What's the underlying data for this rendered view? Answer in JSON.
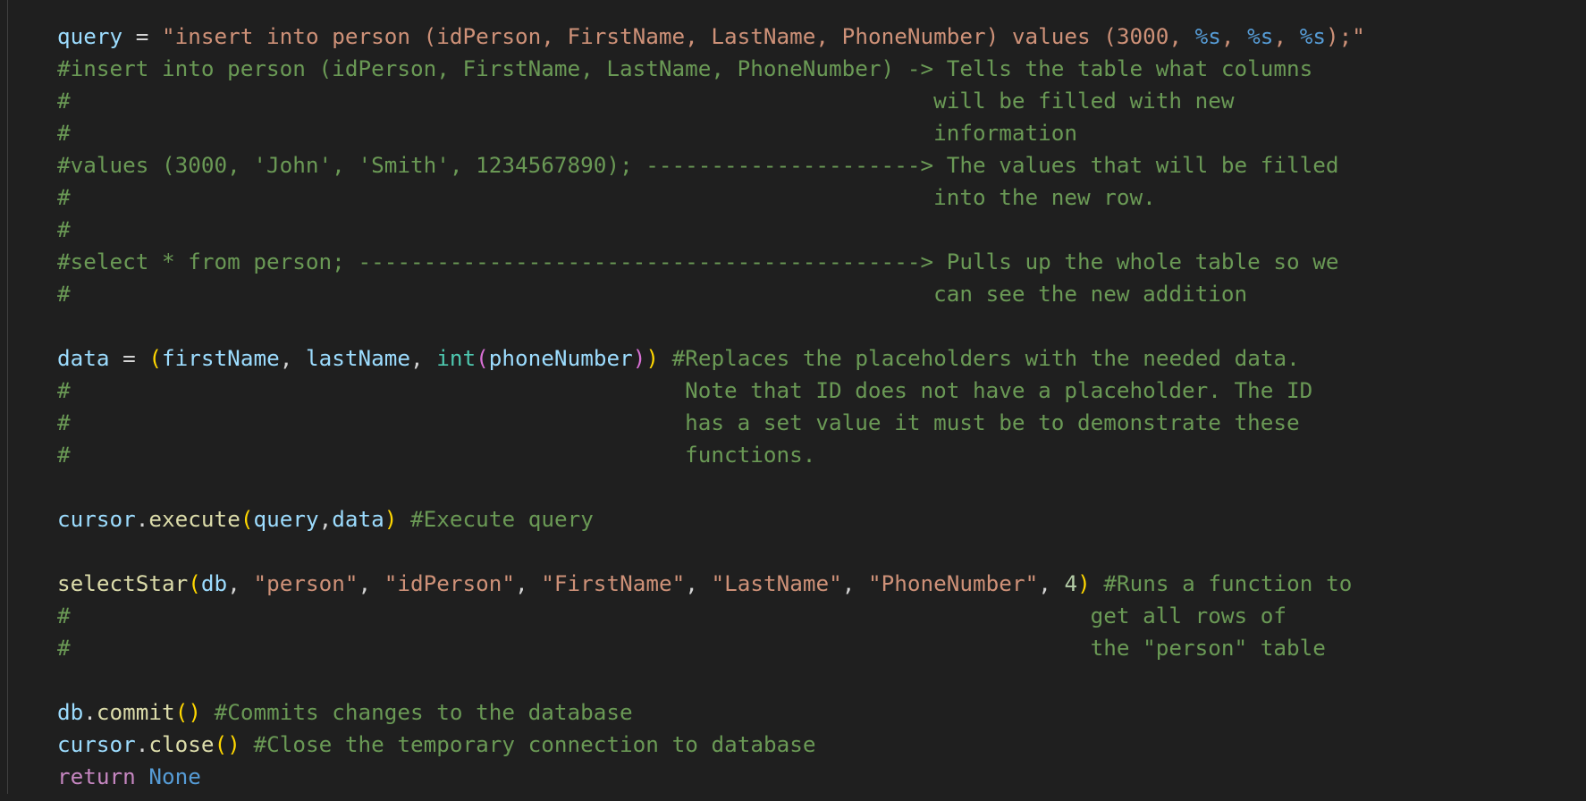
{
  "lines": [
    {
      "segs": [
        {
          "t": "query",
          "c": "v"
        },
        {
          "t": " = ",
          "c": "op"
        },
        {
          "t": "\"insert into person (idPerson, FirstName, LastName, PhoneNumber) values (3000, ",
          "c": "s"
        },
        {
          "t": "%s",
          "c": "e"
        },
        {
          "t": ", ",
          "c": "s"
        },
        {
          "t": "%s",
          "c": "e"
        },
        {
          "t": ", ",
          "c": "s"
        },
        {
          "t": "%s",
          "c": "e"
        },
        {
          "t": ");\"",
          "c": "s"
        }
      ]
    },
    {
      "segs": [
        {
          "t": "#insert into person (idPerson, FirstName, LastName, PhoneNumber) -> Tells the table what columns",
          "c": "c"
        }
      ]
    },
    {
      "segs": [
        {
          "t": "#                                                                  will be filled with new",
          "c": "c"
        }
      ]
    },
    {
      "segs": [
        {
          "t": "#                                                                  information",
          "c": "c"
        }
      ]
    },
    {
      "segs": [
        {
          "t": "#values (3000, 'John', 'Smith', 1234567890); ---------------------> The values that will be filled",
          "c": "c"
        }
      ]
    },
    {
      "segs": [
        {
          "t": "#                                                                  into the new row.",
          "c": "c"
        }
      ]
    },
    {
      "segs": [
        {
          "t": "#",
          "c": "c"
        }
      ]
    },
    {
      "segs": [
        {
          "t": "#select * from person; -------------------------------------------> Pulls up the whole table so we",
          "c": "c"
        }
      ]
    },
    {
      "segs": [
        {
          "t": "#                                                                  can see the new addition",
          "c": "c"
        }
      ]
    },
    {
      "segs": []
    },
    {
      "segs": [
        {
          "t": "data",
          "c": "v"
        },
        {
          "t": " = ",
          "c": "op"
        },
        {
          "t": "(",
          "c": "p1"
        },
        {
          "t": "firstName",
          "c": "v"
        },
        {
          "t": ", ",
          "c": "op"
        },
        {
          "t": "lastName",
          "c": "v"
        },
        {
          "t": ", ",
          "c": "op"
        },
        {
          "t": "int",
          "c": "b"
        },
        {
          "t": "(",
          "c": "p2"
        },
        {
          "t": "phoneNumber",
          "c": "v"
        },
        {
          "t": ")",
          "c": "p2"
        },
        {
          "t": ")",
          "c": "p1"
        },
        {
          "t": " ",
          "c": "op"
        },
        {
          "t": "#Replaces the placeholders with the needed data.",
          "c": "c"
        }
      ]
    },
    {
      "segs": [
        {
          "t": "#                                               Note that ID does not have a placeholder. The ID",
          "c": "c"
        }
      ]
    },
    {
      "segs": [
        {
          "t": "#                                               has a set value it must be to demonstrate these",
          "c": "c"
        }
      ]
    },
    {
      "segs": [
        {
          "t": "#                                               functions.",
          "c": "c"
        }
      ]
    },
    {
      "segs": []
    },
    {
      "segs": [
        {
          "t": "cursor",
          "c": "v"
        },
        {
          "t": ".",
          "c": "op"
        },
        {
          "t": "execute",
          "c": "f"
        },
        {
          "t": "(",
          "c": "p1"
        },
        {
          "t": "query",
          "c": "v"
        },
        {
          "t": ",",
          "c": "op"
        },
        {
          "t": "data",
          "c": "v"
        },
        {
          "t": ")",
          "c": "p1"
        },
        {
          "t": " ",
          "c": "op"
        },
        {
          "t": "#Execute query",
          "c": "c"
        }
      ]
    },
    {
      "segs": []
    },
    {
      "segs": [
        {
          "t": "selectStar",
          "c": "f"
        },
        {
          "t": "(",
          "c": "p1"
        },
        {
          "t": "db",
          "c": "v"
        },
        {
          "t": ", ",
          "c": "op"
        },
        {
          "t": "\"person\"",
          "c": "s"
        },
        {
          "t": ", ",
          "c": "op"
        },
        {
          "t": "\"idPerson\"",
          "c": "s"
        },
        {
          "t": ", ",
          "c": "op"
        },
        {
          "t": "\"FirstName\"",
          "c": "s"
        },
        {
          "t": ", ",
          "c": "op"
        },
        {
          "t": "\"LastName\"",
          "c": "s"
        },
        {
          "t": ", ",
          "c": "op"
        },
        {
          "t": "\"PhoneNumber\"",
          "c": "s"
        },
        {
          "t": ", ",
          "c": "op"
        },
        {
          "t": "4",
          "c": "n"
        },
        {
          "t": ")",
          "c": "p1"
        },
        {
          "t": " ",
          "c": "op"
        },
        {
          "t": "#Runs a function to",
          "c": "c"
        }
      ]
    },
    {
      "segs": [
        {
          "t": "#                                                                              get all rows of",
          "c": "c"
        }
      ]
    },
    {
      "segs": [
        {
          "t": "#                                                                              the \"person\" table",
          "c": "c"
        }
      ]
    },
    {
      "segs": []
    },
    {
      "segs": [
        {
          "t": "db",
          "c": "v"
        },
        {
          "t": ".",
          "c": "op"
        },
        {
          "t": "commit",
          "c": "f"
        },
        {
          "t": "()",
          "c": "p1"
        },
        {
          "t": " ",
          "c": "op"
        },
        {
          "t": "#Commits changes to the database",
          "c": "c"
        }
      ]
    },
    {
      "segs": [
        {
          "t": "cursor",
          "c": "v"
        },
        {
          "t": ".",
          "c": "op"
        },
        {
          "t": "close",
          "c": "f"
        },
        {
          "t": "()",
          "c": "p1"
        },
        {
          "t": " ",
          "c": "op"
        },
        {
          "t": "#Close the temporary connection to database",
          "c": "c"
        }
      ]
    },
    {
      "segs": [
        {
          "t": "return",
          "c": "k"
        },
        {
          "t": " ",
          "c": "op"
        },
        {
          "t": "None",
          "c": "e"
        }
      ]
    }
  ]
}
